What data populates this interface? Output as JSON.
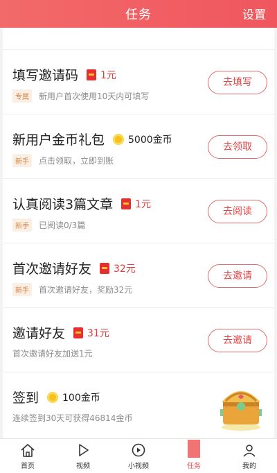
{
  "header": {
    "title": "任务",
    "settings_label": "设置"
  },
  "tasks": [
    {
      "title": "填写邀请码",
      "reward_type": "redpacket",
      "reward": "1元",
      "tag": "专属",
      "desc": "新用户首次使用10天内可填写",
      "button": "去填写"
    },
    {
      "title": "新用户金币礼包",
      "reward_type": "coin",
      "reward": "5000金币",
      "tag": "新手",
      "desc": "点击领取，立即到账",
      "button": "去领取"
    },
    {
      "title": "认真阅读3篇文章",
      "reward_type": "redpacket",
      "reward": "1元",
      "tag": "新手",
      "desc": "已阅读0/3篇",
      "button": "去阅读"
    },
    {
      "title": "首次邀请好友",
      "reward_type": "redpacket",
      "reward": "32元",
      "tag": "新手",
      "desc": "首次邀请好友，奖励32元",
      "button": "去邀请"
    },
    {
      "title": "邀请好友",
      "reward_type": "redpacket",
      "reward": "31元",
      "tag": "",
      "desc": "首次邀请好友加送1元",
      "button": "去邀请"
    },
    {
      "title": "签到",
      "reward_type": "coin",
      "reward": "100金币",
      "tag": "",
      "desc": "连续签到30天可获得46814金币",
      "button": ""
    }
  ],
  "tabbar": {
    "tabs": [
      {
        "label": "首页",
        "icon": "home-icon"
      },
      {
        "label": "视频",
        "icon": "play-icon"
      },
      {
        "label": "小视频",
        "icon": "small-video-icon"
      },
      {
        "label": "任务",
        "icon": "task-icon",
        "active": true
      },
      {
        "label": "我的",
        "icon": "profile-icon"
      }
    ]
  },
  "colors": {
    "accent": "#f05a5a",
    "button_text": "#e04545",
    "tag_bg": "#fbeee2",
    "tag_text": "#d2854a"
  }
}
